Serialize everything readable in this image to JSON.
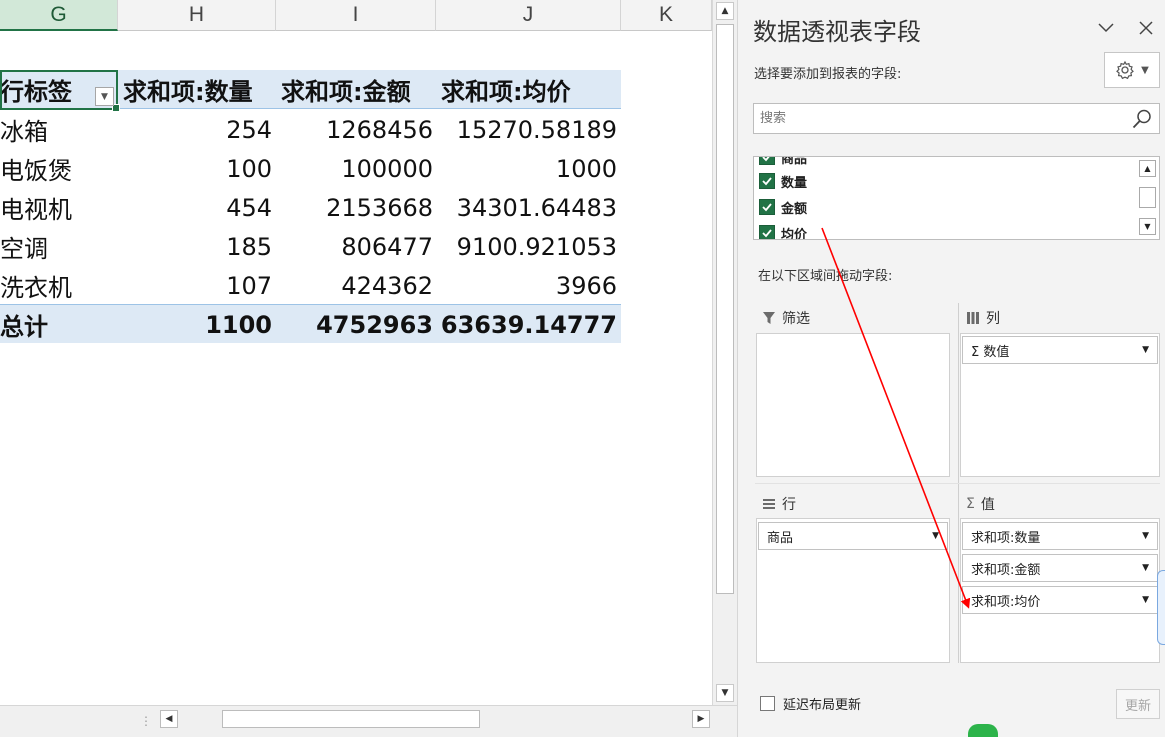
{
  "colors": {
    "accent": "#217346",
    "pivot_header": "#dde9f5",
    "arrow": "#ff0000"
  },
  "sheet": {
    "columns": [
      "G",
      "H",
      "I",
      "J",
      "K"
    ],
    "selected_column": "G",
    "pivot": {
      "header": {
        "label": "行标签",
        "c1": "求和项:数量",
        "c2": "求和项:金额",
        "c3": "求和项:均价"
      },
      "rows": [
        {
          "label": "冰箱",
          "c1": "254",
          "c2": "1268456",
          "c3": "15270.58189"
        },
        {
          "label": "电饭煲",
          "c1": "100",
          "c2": "100000",
          "c3": "1000"
        },
        {
          "label": "电视机",
          "c1": "454",
          "c2": "2153668",
          "c3": "34301.64483"
        },
        {
          "label": "空调",
          "c1": "185",
          "c2": "806477",
          "c3": "9100.921053"
        },
        {
          "label": "洗衣机",
          "c1": "107",
          "c2": "424362",
          "c3": "3966"
        }
      ],
      "total": {
        "label": "总计",
        "c1": "1100",
        "c2": "4752963",
        "c3": "63639.14777"
      }
    }
  },
  "panel": {
    "title": "数据透视表字段",
    "subtitle": "选择要添加到报表的字段:",
    "search_placeholder": "搜索",
    "fields": [
      {
        "label": "商品",
        "checked": true
      },
      {
        "label": "数量",
        "checked": true
      },
      {
        "label": "金额",
        "checked": true
      },
      {
        "label": "均价",
        "checked": true
      }
    ],
    "drag_hint": "在以下区域间拖动字段:",
    "areas": {
      "filter": {
        "label": "筛选",
        "icon": "filter-icon",
        "items": []
      },
      "columns": {
        "label": "列",
        "icon": "columns-icon",
        "items": [
          "Σ 数值"
        ]
      },
      "rows": {
        "label": "行",
        "icon": "rows-icon",
        "items": [
          "商品"
        ]
      },
      "values": {
        "label": "值",
        "icon": "sigma-icon",
        "items": [
          "求和项:数量",
          "求和项:金额",
          "求和项:均价"
        ]
      }
    },
    "defer_label": "延迟布局更新",
    "update_label": "更新"
  }
}
